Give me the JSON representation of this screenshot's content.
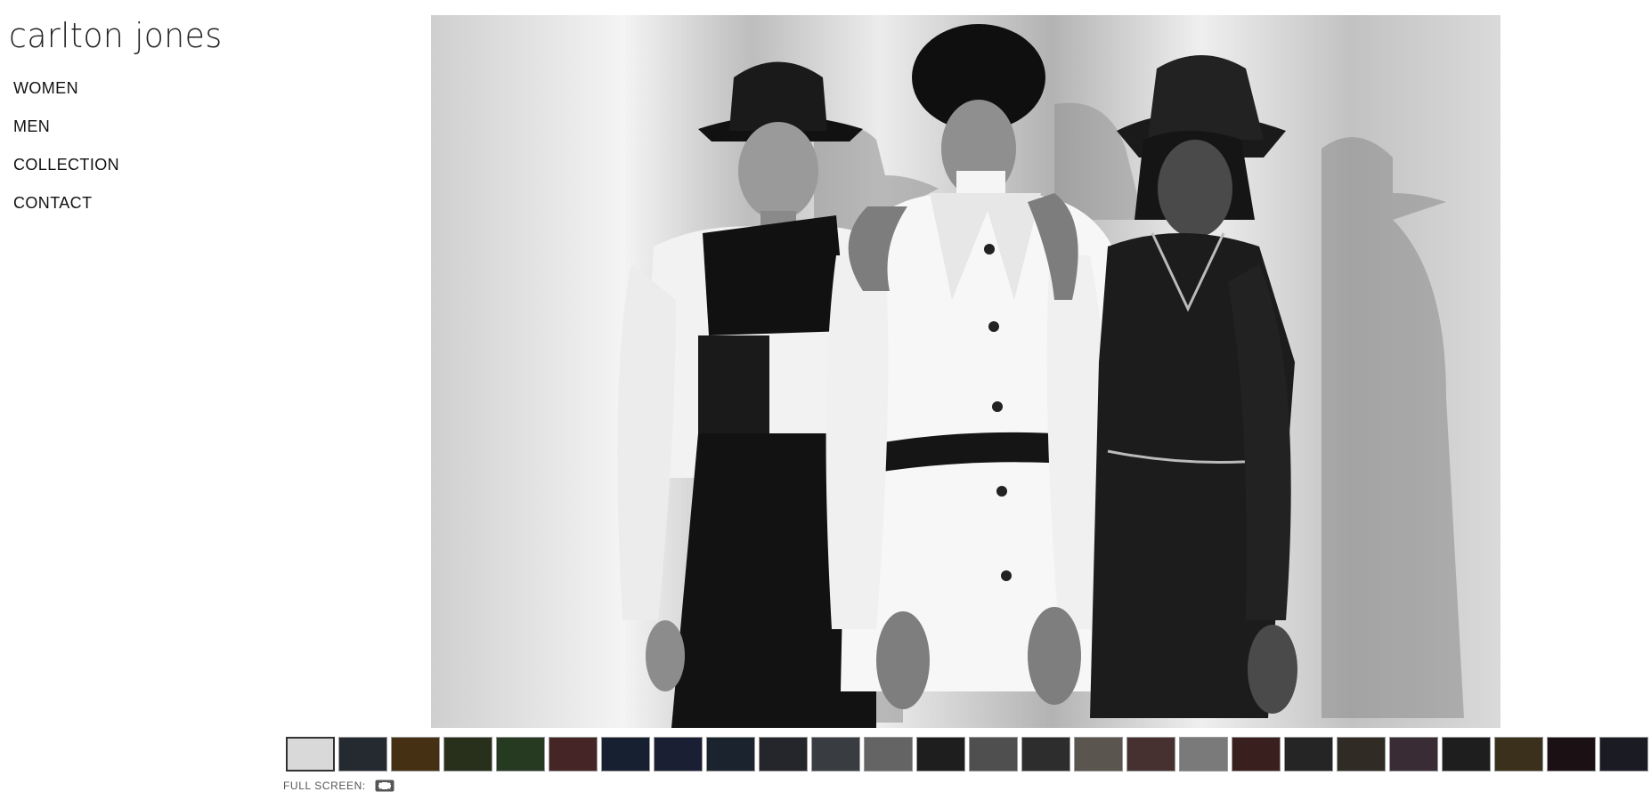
{
  "site": {
    "logo_text": "carlton jones"
  },
  "nav": {
    "items": [
      {
        "label": "WOMEN"
      },
      {
        "label": "MEN"
      },
      {
        "label": "COLLECTION"
      },
      {
        "label": "CONTACT"
      }
    ]
  },
  "gallery": {
    "fullscreen_label": "FULL SCREEN:",
    "thumbnail_colors": [
      "#d9d9d9",
      "#3a3f4a",
      "#6a4a1e",
      "#3e4a2a",
      "#3a5a34",
      "#6a3a3a",
      "#24324a",
      "#2a3150",
      "#2a3848",
      "#3a3a44",
      "#585e66",
      "#9a9a9a",
      "#2e2e2e",
      "#7a7a7a",
      "#454545",
      "#8a8378",
      "#6e4a4a",
      "#bcbcbc",
      "#5a3030",
      "#3a3a3a",
      "#4a423a",
      "#5a4450",
      "#2e2e2e",
      "#5a4a2a",
      "#2a1a20",
      "#2a2a38"
    ]
  }
}
